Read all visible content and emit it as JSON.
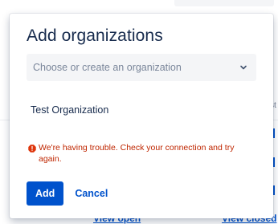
{
  "dialog": {
    "title": "Add organizations",
    "select_placeholder": "Choose or create an organization",
    "selected_items": [
      "Test Organization"
    ],
    "error_text": "We're having trouble. Check your connection and try again.",
    "add_label": "Add",
    "cancel_label": "Cancel"
  },
  "background": {
    "edge_text": "st",
    "link_open": "View open",
    "link_closed": "View closed"
  },
  "icons": {
    "select": "chevron-down-icon",
    "error": "warning-icon"
  },
  "colors": {
    "primary": "#0052cc",
    "error": "#bf2600",
    "text": "#172b4d",
    "placeholder": "#7a869a",
    "field_bg": "#f4f5f7"
  }
}
